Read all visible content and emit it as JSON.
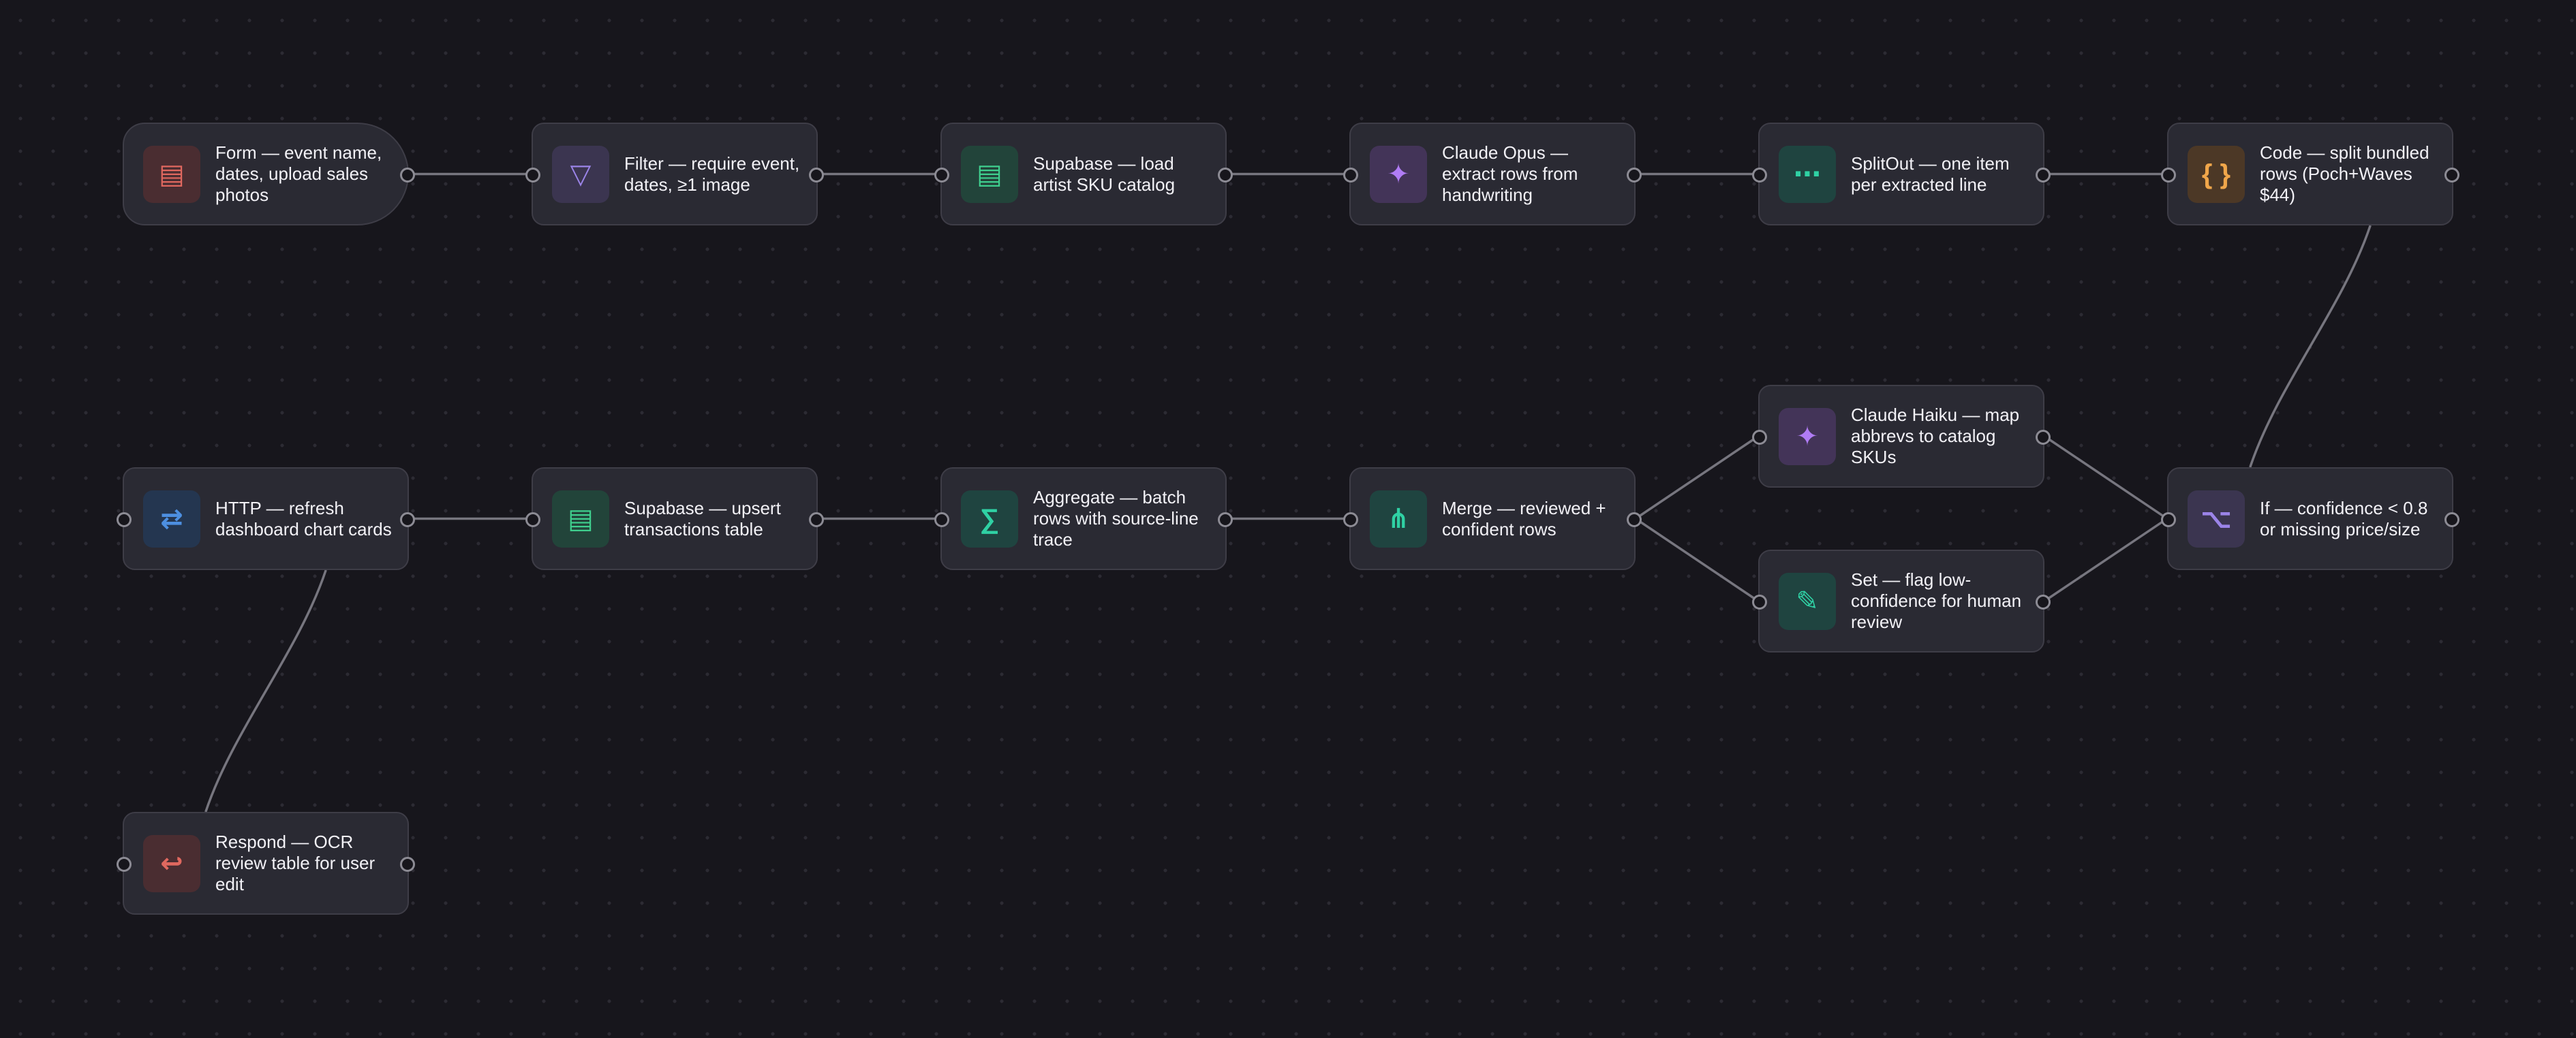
{
  "canvas": {
    "background": "#17161c",
    "edge_color": "#77767f"
  },
  "nodes": [
    {
      "id": "form",
      "label": "Form — event name, dates, upload sales photos",
      "icon": "form-icon",
      "glyph": "▤",
      "color": "#e0685f",
      "tint": "#4a2d31",
      "shape": "trigger"
    },
    {
      "id": "filter",
      "label": "Filter — require event, dates, ≥1 image",
      "icon": "filter-icon",
      "glyph": "▽",
      "color": "#9b84e8",
      "tint": "#3b3550"
    },
    {
      "id": "supabase-load",
      "label": "Supabase — load artist SKU catalog",
      "icon": "database-icon",
      "glyph": "▤",
      "color": "#3fcf8e",
      "tint": "#22443a"
    },
    {
      "id": "claude-opus",
      "label": "Claude Opus — extract rows from handwriting",
      "icon": "sparkle-icon",
      "glyph": "✦",
      "color": "#b07cf5",
      "tint": "#433458"
    },
    {
      "id": "splitout",
      "label": "SplitOut — one item per extracted line",
      "icon": "split-icon",
      "glyph": "⋯",
      "color": "#2fd1a4",
      "tint": "#1f4440"
    },
    {
      "id": "code",
      "label": "Code — split bundled rows (Poch+Waves $44)",
      "icon": "code-icon",
      "glyph": "{ }",
      "color": "#f0a64a",
      "tint": "#4c3826"
    },
    {
      "id": "claude-haiku",
      "label": "Claude Haiku — map abbrevs to catalog SKUs",
      "icon": "sparkle-icon",
      "glyph": "✦",
      "color": "#b07cf5",
      "tint": "#433458"
    },
    {
      "id": "http",
      "label": "HTTP — refresh dashboard chart cards",
      "icon": "arrows-icon",
      "glyph": "⇄",
      "color": "#4d8fe0",
      "tint": "#243650"
    },
    {
      "id": "supabase-upsert",
      "label": "Supabase — upsert transactions table",
      "icon": "database-icon",
      "glyph": "▤",
      "color": "#3fcf8e",
      "tint": "#22443a"
    },
    {
      "id": "aggregate",
      "label": "Aggregate — batch rows with source-line trace",
      "icon": "sigma-icon",
      "glyph": "∑",
      "color": "#2fd1a4",
      "tint": "#1f4440"
    },
    {
      "id": "merge",
      "label": "Merge — reviewed + confident rows",
      "icon": "merge-icon",
      "glyph": "⋔",
      "color": "#2fd1a4",
      "tint": "#1f4440"
    },
    {
      "id": "if",
      "label": "If — confidence < 0.8 or missing price/size",
      "icon": "branch-icon",
      "glyph": "⌥",
      "color": "#9b84e8",
      "tint": "#3b3550"
    },
    {
      "id": "set",
      "label": "Set — flag low-confidence for human review",
      "icon": "pencil-icon",
      "glyph": "✎",
      "color": "#2fd1a4",
      "tint": "#1f4440"
    },
    {
      "id": "respond",
      "label": "Respond — OCR review table for user edit",
      "icon": "return-icon",
      "glyph": "↩",
      "color": "#e0685f",
      "tint": "#4a2d31"
    }
  ],
  "edges": [
    [
      "form",
      "filter"
    ],
    [
      "filter",
      "supabase-load"
    ],
    [
      "supabase-load",
      "claude-opus"
    ],
    [
      "claude-opus",
      "splitout"
    ],
    [
      "splitout",
      "code"
    ],
    [
      "code",
      "if"
    ],
    [
      "if",
      "claude-haiku"
    ],
    [
      "if",
      "set"
    ],
    [
      "claude-haiku",
      "merge"
    ],
    [
      "set",
      "merge"
    ],
    [
      "merge",
      "aggregate"
    ],
    [
      "aggregate",
      "supabase-upsert"
    ],
    [
      "supabase-upsert",
      "http"
    ],
    [
      "http",
      "respond"
    ]
  ]
}
